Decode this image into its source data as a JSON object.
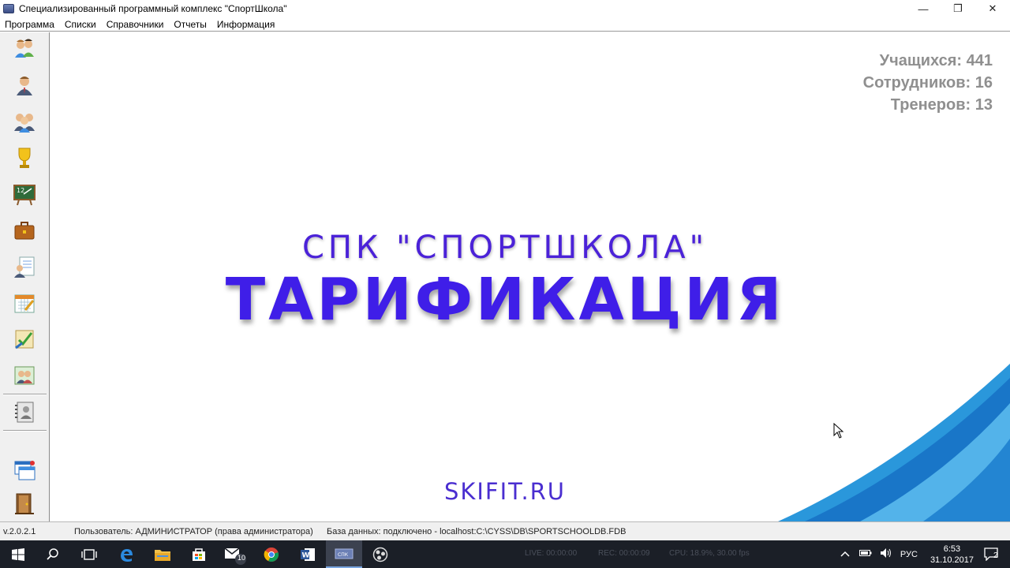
{
  "window": {
    "title": "Специализированный программный комплекс \"СпортШкола\"",
    "controls": {
      "minimize": "—",
      "restore": "❐",
      "close": "✕"
    }
  },
  "menu": {
    "items": [
      "Программа",
      "Списки",
      "Справочники",
      "Отчеты",
      "Информация"
    ]
  },
  "sidebar": {
    "icons": [
      "students-group-icon",
      "employee-icon",
      "coaches-group-icon",
      "trophy-icon",
      "schedule-board-icon",
      "briefcase-icon",
      "user-card-icon",
      "calendar-icon",
      "checklist-icon",
      "people-card-icon",
      "address-book-icon",
      "windows-icon",
      "exit-door-icon"
    ]
  },
  "stats": {
    "students": "Учащихся: 441",
    "employees": "Сотрудников: 16",
    "coaches": "Тренеров: 13"
  },
  "logo": {
    "line1": "СПК \"СПОРТШКОЛА\"",
    "line2": "ТАРИФИКАЦИЯ",
    "site": "SKIFIT.RU"
  },
  "status": {
    "version": "v.2.0.2.1",
    "user": "Пользователь: АДМИНИСТРАТОР (права администратора)",
    "database": "База данных: подключено - localhost:C:\\CYSS\\DB\\SPORTSCHOOLDB.FDB"
  },
  "taskbar": {
    "mail_badge": "10",
    "rec_live": "LIVE: 00:00:00",
    "rec_rec": "REC: 00:00:09",
    "rec_cpu": "CPU: 18.9%, 30.00 fps",
    "lang": "РУС",
    "time": "6:53",
    "date": "31.10.2017",
    "notifications": "2"
  },
  "colors": {
    "logo_blue": "#3f1ee8",
    "stats_gray": "#8f8f8f",
    "swoosh_blue": "#1a8fd6",
    "taskbar_bg": "#1b1f27"
  }
}
